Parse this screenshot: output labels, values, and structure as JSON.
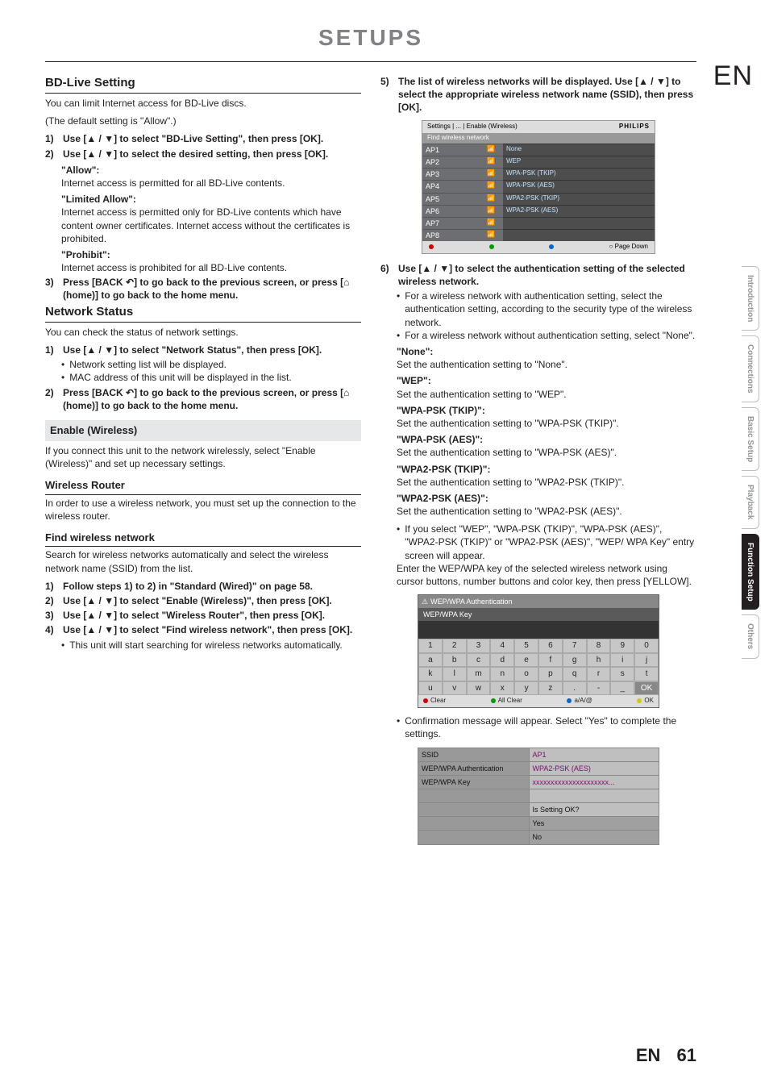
{
  "page_title": "SETUPS",
  "lang_marker": "EN",
  "page_number": "61",
  "left": {
    "bd_live_heading": "BD-Live Setting",
    "bd_live_intro1": "You can limit Internet access for BD-Live discs.",
    "bd_live_intro2": "(The default setting is \"Allow\".)",
    "step1": "Use [▲ / ▼] to select \"BD-Live Setting\", then press [OK].",
    "step2": "Use [▲ / ▼] to select the desired setting, then press [OK].",
    "allow_label": "\"Allow\":",
    "allow_text": "Internet access is permitted for all BD-Live contents.",
    "limited_label": "\"Limited Allow\":",
    "limited_text": "Internet access is permitted only for BD-Live contents which have content owner certificates. Internet access without the certificates is prohibited.",
    "prohibit_label": "\"Prohibit\":",
    "prohibit_text": "Internet access is prohibited for all BD-Live contents.",
    "step3": "Press [BACK ↶] to go back to the previous screen, or press [⌂ (home)] to go back to the home menu.",
    "net_status_heading": "Network Status",
    "net_status_intro": "You can check the status of network settings.",
    "ns_step1": "Use [▲ / ▼] to select \"Network Status\", then press [OK].",
    "ns_b1": "Network setting list will be displayed.",
    "ns_b2": "MAC address of this unit will be displayed in the list.",
    "ns_step2": "Press [BACK ↶] to go back to the previous screen, or press [⌂ (home)] to go back to the home menu.",
    "enable_heading": "Enable (Wireless)",
    "enable_intro": "If you connect this unit to the network wirelessly, select \"Enable (Wireless)\" and set up necessary settings.",
    "wr_heading": "Wireless Router",
    "wr_intro": "In order to use a wireless network, you must set up the connection to the wireless router.",
    "fw_heading": "Find wireless network",
    "fw_intro": "Search for wireless networks automatically and select the wireless network name (SSID) from the list.",
    "fw_step1": "Follow steps 1) to 2) in \"Standard (Wired)\" on page 58.",
    "fw_step2": "Use [▲ / ▼] to select \"Enable (Wireless)\", then press [OK].",
    "fw_step3": "Use [▲ / ▼] to select \"Wireless Router\", then press [OK].",
    "fw_step4": "Use [▲ / ▼] to select \"Find wireless network\", then press [OK].",
    "fw_step4_b": "This unit will start searching for wireless networks automatically."
  },
  "right": {
    "step5": "The list of wireless networks will be displayed. Use [▲ / ▼] to select the appropriate wireless network name (SSID), then press [OK].",
    "netlist_header": "Settings | ... | Enable (Wireless)",
    "netlist_brand": "PHILIPS",
    "netlist_sub": "Find wireless network",
    "rows": [
      {
        "ap": "AP1",
        "sec": "None"
      },
      {
        "ap": "AP2",
        "sec": "WEP"
      },
      {
        "ap": "AP3",
        "sec": "WPA-PSK (TKIP)"
      },
      {
        "ap": "AP4",
        "sec": "WPA-PSK (AES)"
      },
      {
        "ap": "AP5",
        "sec": "WPA2-PSK (TKIP)"
      },
      {
        "ap": "AP6",
        "sec": "WPA2-PSK (AES)"
      },
      {
        "ap": "AP7",
        "sec": ""
      },
      {
        "ap": "AP8",
        "sec": ""
      }
    ],
    "netfoot_page": "○ Page Down",
    "step6": "Use [▲ / ▼] to select the authentication setting of the selected wireless network.",
    "step6_b1": "For a wireless network with authentication setting, select the authentication setting, according to the security type of the wireless network.",
    "step6_b2": "For a wireless network without authentication setting, select \"None\".",
    "none_l": "\"None\":",
    "none_t": "Set the authentication setting to \"None\".",
    "wep_l": "\"WEP\":",
    "wep_t": "Set the authentication setting to \"WEP\".",
    "wpt_l": "\"WPA-PSK (TKIP)\":",
    "wpt_t": "Set the authentication setting to \"WPA-PSK (TKIP)\".",
    "wpa_l": "\"WPA-PSK (AES)\":",
    "wpa_t": "Set the authentication setting to \"WPA-PSK (AES)\".",
    "wp2t_l": "\"WPA2-PSK (TKIP)\":",
    "wp2t_t": "Set the authentication setting to \"WPA2-PSK (TKIP)\".",
    "wp2a_l": "\"WPA2-PSK (AES)\":",
    "wp2a_t": "Set the authentication setting to \"WPA2-PSK (AES)\".",
    "note_bullet": "If you select \"WEP\", \"WPA-PSK (TKIP)\", \"WPA-PSK (AES)\", \"WPA2-PSK (TKIP)\" or \"WPA2-PSK (AES)\", \"WEP/ WPA Key\" entry screen will appear.",
    "note_cont": "Enter the WEP/WPA key of the selected wireless network using cursor buttons, number buttons and color key, then press [YELLOW].",
    "kb_title": "WEP/WPA Authentication",
    "kb_sub": "WEP/WPA Key",
    "kb_rows": [
      [
        "1",
        "2",
        "3",
        "4",
        "5",
        "6",
        "7",
        "8",
        "9",
        "0"
      ],
      [
        "a",
        "b",
        "c",
        "d",
        "e",
        "f",
        "g",
        "h",
        "i",
        "j"
      ],
      [
        "k",
        "l",
        "m",
        "n",
        "o",
        "p",
        "q",
        "r",
        "s",
        "t"
      ],
      [
        "u",
        "v",
        "w",
        "x",
        "y",
        "z",
        ".",
        "-",
        "_",
        "OK"
      ]
    ],
    "kb_clear": "Clear",
    "kb_allclear": "All Clear",
    "kb_case": "a/A/@",
    "kb_ok": "OK",
    "confirm_text": "Confirmation message will appear. Select \"Yes\" to complete the settings.",
    "conf": {
      "ssid_l": "SSID",
      "ssid_v": "AP1",
      "auth_l": "WEP/WPA Authentication",
      "auth_v": "WPA2-PSK (AES)",
      "key_l": "WEP/WPA Key",
      "key_v": "xxxxxxxxxxxxxxxxxxxxx...",
      "q": "Is Setting OK?",
      "yes": "Yes",
      "no": "No"
    }
  },
  "tabs": [
    "Introduction",
    "Connections",
    "Basic Setup",
    "Playback",
    "Function Setup",
    "Others"
  ],
  "active_tab": 4
}
